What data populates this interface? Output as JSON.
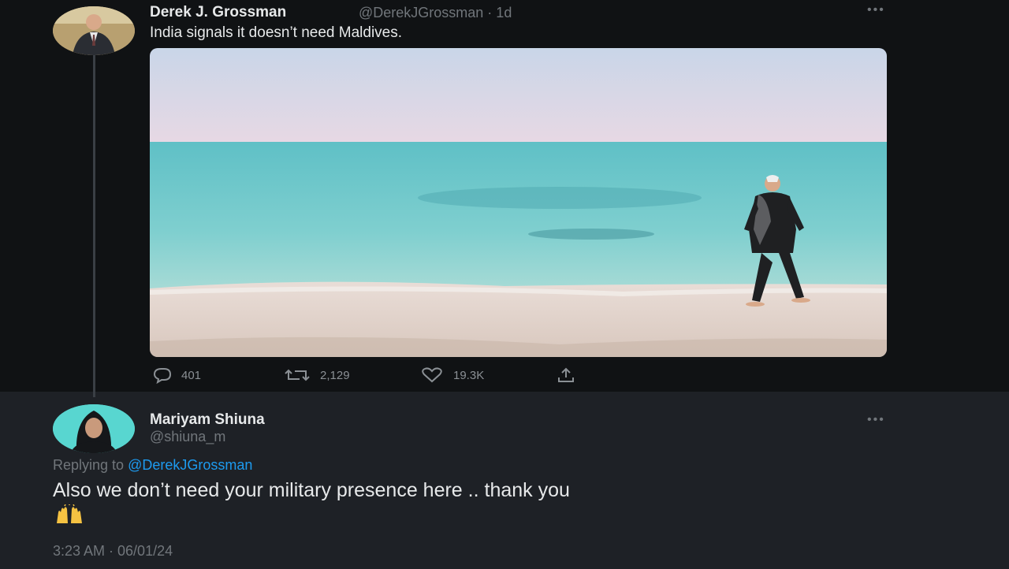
{
  "original_tweet": {
    "author_name": "Derek J. Grossman",
    "handle_time": "@DerekJGrossman · 1d",
    "text": "India signals it doesn’t need Maldives.",
    "actions": {
      "replies": "401",
      "retweets": "2,129",
      "likes": "19.3K"
    }
  },
  "reply_tweet": {
    "author_name": "Mariyam Shiuna",
    "handle": "@shiuna_m",
    "replying_to_prefix": "Replying to",
    "replying_to_handle": "@DerekJGrossman",
    "text": "Also we don’t need your military presence here .. thank you",
    "timestamp": "3:23 AM · 06/01/24"
  },
  "icons": {
    "more": "more-horizontal-icon",
    "reply": "reply-icon",
    "retweet": "retweet-icon",
    "like": "heart-icon",
    "share": "share-icon",
    "emoji": "raising-hands-emoji"
  },
  "colors": {
    "accent": "#1d9bf0",
    "muted": "#71767b"
  }
}
